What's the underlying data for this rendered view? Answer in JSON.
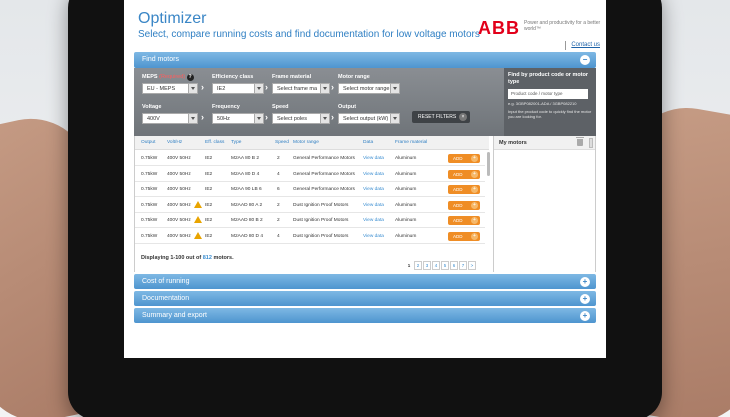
{
  "header": {
    "title": "Optimizer",
    "subtitle": "Select, compare running costs and find documentation for low voltage motors",
    "logo": "ABB",
    "tagline": "Power and productivity for a better world™",
    "contact": "Contact us"
  },
  "find_motors": {
    "title": "Find motors",
    "toggle": "−",
    "filters": {
      "meps": {
        "label": "MEPS",
        "required": "(Required)",
        "help": "?",
        "value": "EU - MEPS"
      },
      "efficiency": {
        "label": "Efficiency class",
        "value": "IE2"
      },
      "frame": {
        "label": "Frame material",
        "value": "Select frame ma"
      },
      "range": {
        "label": "Motor range",
        "value": "Select motor range"
      },
      "voltage": {
        "label": "Voltage",
        "value": "400V"
      },
      "frequency": {
        "label": "Frequency",
        "value": "50Hz"
      },
      "speed": {
        "label": "Speed",
        "value": "Select poles"
      },
      "output": {
        "label": "Output",
        "value": "Select output (kW)"
      },
      "reset": "RESET FILTERS",
      "reset_icon": "×"
    },
    "product_code": {
      "title": "Find by product code or motor type",
      "placeholder": "Product code / motor type",
      "example": "e.g. 3GBP082001-ADA / 3GBP082210",
      "help": "Input the product code to quickly find the motor you are looking for."
    }
  },
  "table": {
    "columns": [
      "Output",
      "Volt/Hz",
      "Eff. class",
      "Type",
      "Speed",
      "Motor range",
      "Data",
      "Frame material"
    ],
    "rows": [
      {
        "output": "0.75kW",
        "volt": "400V 50Hz",
        "warn": false,
        "eff": "IE2",
        "type": "M2AA 80 B 2",
        "speed": "2",
        "range": "General Performance Motors",
        "data": "View data",
        "frame": "Aluminum",
        "add": "ADD"
      },
      {
        "output": "0.75kW",
        "volt": "400V 50Hz",
        "warn": false,
        "eff": "IE2",
        "type": "M2AA 80 D 4",
        "speed": "4",
        "range": "General Performance Motors",
        "data": "View data",
        "frame": "Aluminum",
        "add": "ADD"
      },
      {
        "output": "0.75kW",
        "volt": "400V 50Hz",
        "warn": false,
        "eff": "IE2",
        "type": "M2AA 90 LB 6",
        "speed": "6",
        "range": "General Performance Motors",
        "data": "View data",
        "frame": "Aluminum",
        "add": "ADD"
      },
      {
        "output": "0.75kW",
        "volt": "400V 50Hz",
        "warn": true,
        "eff": "IE2",
        "type": "M2AAD 80 A 2",
        "speed": "2",
        "range": "Dust Ignition Proof Motors",
        "data": "View data",
        "frame": "Aluminum",
        "add": "ADD"
      },
      {
        "output": "0.75kW",
        "volt": "400V 50Hz",
        "warn": true,
        "eff": "IE2",
        "type": "M2AAD 80 B 2",
        "speed": "2",
        "range": "Dust Ignition Proof Motors",
        "data": "View data",
        "frame": "Aluminum",
        "add": "ADD"
      },
      {
        "output": "0.75kW",
        "volt": "400V 50Hz",
        "warn": true,
        "eff": "IE2",
        "type": "M2AAD 80 D 4",
        "speed": "4",
        "range": "Dust Ignition Proof Motors",
        "data": "View data",
        "frame": "Aluminum",
        "add": "ADD"
      }
    ],
    "add_icon": "+",
    "displaying_prefix": "Displaying 1-100 out of ",
    "displaying_count": "812",
    "displaying_suffix": " motors.",
    "pages": [
      "1",
      "2",
      "3",
      "4",
      "5",
      "6",
      "7",
      ">"
    ]
  },
  "my_motors": {
    "title": "My motors"
  },
  "sections": [
    {
      "title": "Cost of running",
      "toggle": "+"
    },
    {
      "title": "Documentation",
      "toggle": "+"
    },
    {
      "title": "Summary and export",
      "toggle": "+"
    }
  ],
  "colors": {
    "accent": "#3a86c6",
    "add": "#ef8d25",
    "brand": "#e2001a"
  }
}
